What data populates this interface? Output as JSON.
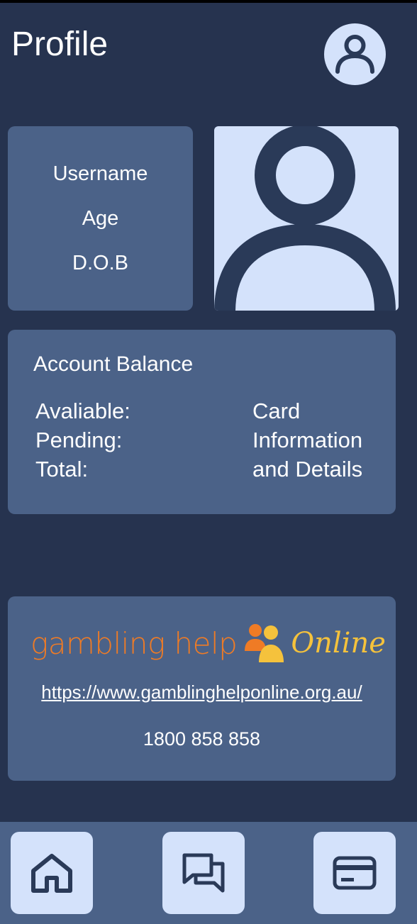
{
  "header": {
    "title": "Profile",
    "avatar_icon": "user-icon"
  },
  "profile": {
    "username_label": "Username",
    "age_label": "Age",
    "dob_label": "D.O.B",
    "photo_icon": "user-silhouette-icon"
  },
  "account": {
    "title": "Account Balance",
    "available_label": "Avaliable:",
    "pending_label": "Pending:",
    "total_label": "Total:",
    "card_line1": "Card",
    "card_line2": "Information",
    "card_line3": "and Details"
  },
  "help": {
    "logo_left": "gambling help",
    "logo_right": "Online",
    "logo_icon": "people-icon",
    "url": "https://www.gamblinghelponline.org.au/",
    "phone": "1800 858 858"
  },
  "nav": {
    "items": [
      {
        "name": "home",
        "icon": "home-icon"
      },
      {
        "name": "chat",
        "icon": "chat-icon"
      },
      {
        "name": "card",
        "icon": "credit-card-icon"
      }
    ]
  },
  "colors": {
    "background": "#26334f",
    "card": "#4b6288",
    "light": "#d4e2fb",
    "dark_icon": "#2a3a58",
    "orange": "#ef7b25",
    "yellow": "#f5c23c"
  }
}
